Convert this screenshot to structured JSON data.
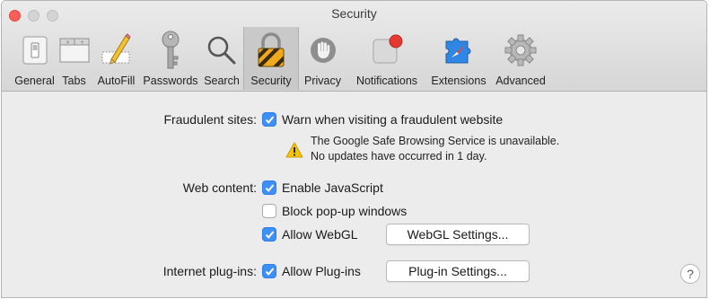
{
  "window": {
    "title": "Security"
  },
  "tabs": [
    {
      "label": "General",
      "icon": "general-switch-icon"
    },
    {
      "label": "Tabs",
      "icon": "tabs-icon"
    },
    {
      "label": "AutoFill",
      "icon": "autofill-pencil-icon"
    },
    {
      "label": "Passwords",
      "icon": "key-icon"
    },
    {
      "label": "Search",
      "icon": "magnifier-icon"
    },
    {
      "label": "Security",
      "icon": "padlock-icon",
      "active": true
    },
    {
      "label": "Privacy",
      "icon": "hand-icon"
    },
    {
      "label": "Notifications",
      "icon": "notifications-icon"
    },
    {
      "label": "Extensions",
      "icon": "extensions-puzzle-icon"
    },
    {
      "label": "Advanced",
      "icon": "gear-icon"
    }
  ],
  "fraudulent": {
    "label": "Fraudulent sites:",
    "checkbox": {
      "label": "Warn when visiting a fraudulent website",
      "checked": true
    },
    "warning_line1": "The Google Safe Browsing Service is unavailable.",
    "warning_line2": "No updates have occurred in 1 day."
  },
  "web_content": {
    "label": "Web content:",
    "javascript": {
      "label": "Enable JavaScript",
      "checked": true
    },
    "popups": {
      "label": "Block pop-up windows",
      "checked": false
    },
    "webgl": {
      "label": "Allow WebGL",
      "checked": true
    },
    "webgl_settings": "WebGL Settings..."
  },
  "plugins": {
    "label": "Internet plug-ins:",
    "allow": {
      "label": "Allow Plug-ins",
      "checked": true
    },
    "settings": "Plug-in Settings..."
  },
  "help": "?",
  "colors": {
    "accent": "#3e8ff6",
    "warning": "#f5c400",
    "close": "#fc5f57"
  }
}
